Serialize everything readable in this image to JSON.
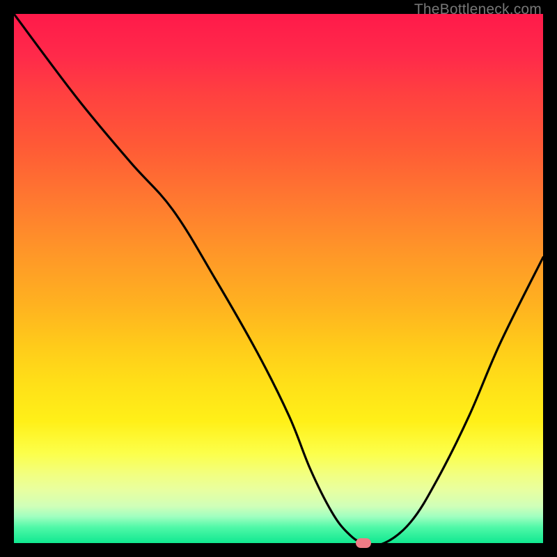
{
  "watermark": "TheBottleneck.com",
  "chart_data": {
    "type": "line",
    "title": "",
    "xlabel": "",
    "ylabel": "",
    "xlim": [
      0,
      100
    ],
    "ylim": [
      0,
      100
    ],
    "grid": false,
    "gradient_stops": [
      {
        "pos": 0,
        "color": "#ff1a4a"
      },
      {
        "pos": 100,
        "color": "#10e890"
      }
    ],
    "series": [
      {
        "name": "bottleneck-curve",
        "x": [
          0,
          12,
          22,
          30,
          38,
          46,
          52,
          56,
          60,
          63,
          66,
          70,
          75,
          80,
          86,
          92,
          100
        ],
        "y": [
          100,
          84,
          72,
          63,
          50,
          36,
          24,
          14,
          6,
          2,
          0,
          0,
          4,
          12,
          24,
          38,
          54
        ]
      }
    ],
    "marker": {
      "x": 66,
      "y": 0,
      "color": "#ef7b86"
    }
  }
}
